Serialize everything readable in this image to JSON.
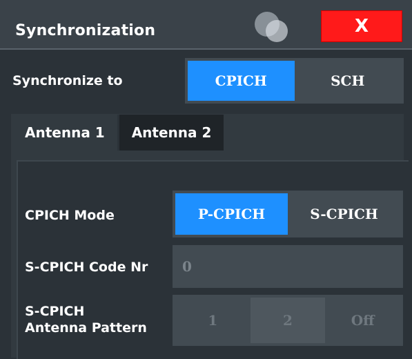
{
  "dialog": {
    "title": "Synchronization",
    "close_label": "X"
  },
  "sync": {
    "label": "Synchronize to",
    "options": [
      "CPICH",
      "SCH"
    ],
    "selected": "CPICH"
  },
  "tabs": [
    {
      "label": "Antenna 1",
      "active": true
    },
    {
      "label": "Antenna 2",
      "active": false
    }
  ],
  "cpich_mode": {
    "label": "CPICH Mode",
    "options": [
      "P-CPICH",
      "S-CPICH"
    ],
    "selected": "P-CPICH"
  },
  "code_nr": {
    "label": "S-CPICH Code Nr",
    "value": "0"
  },
  "antenna_pattern": {
    "label_line1": "S-CPICH",
    "label_line2": "Antenna Pattern",
    "options": [
      "1",
      "2",
      "Off"
    ],
    "selected": "2"
  },
  "colors": {
    "accent": "#1e90ff",
    "close": "#ff1a1a",
    "background": "#2b3238"
  }
}
